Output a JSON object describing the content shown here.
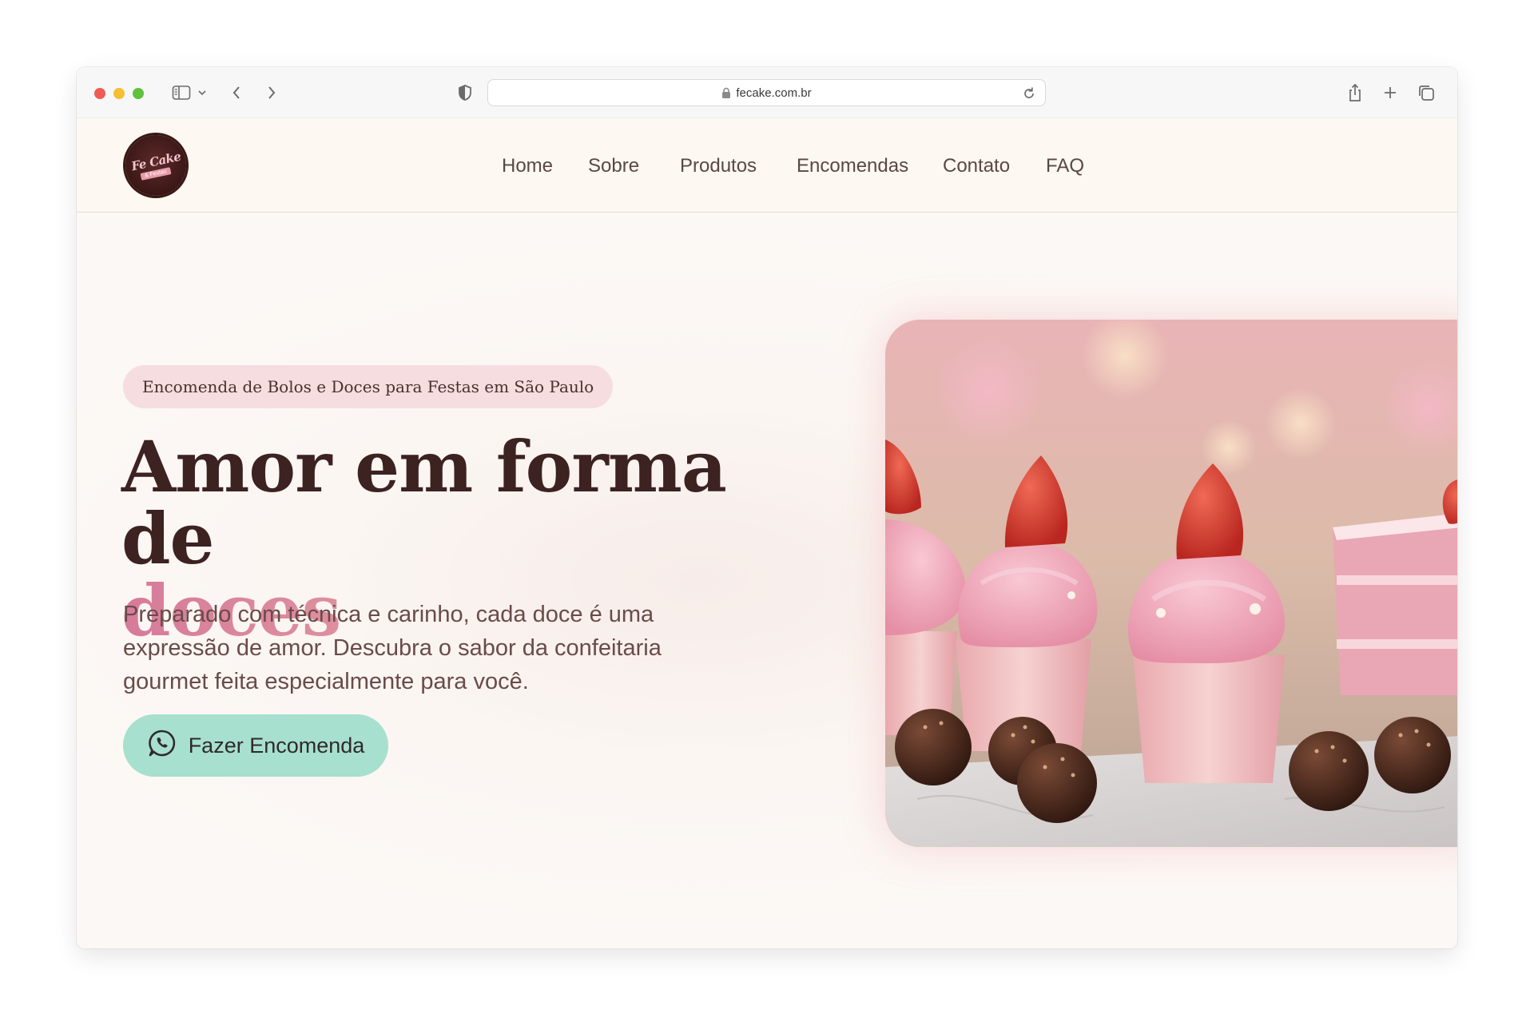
{
  "browser": {
    "url": "fecake.com.br",
    "icons": [
      "sidebar-icon",
      "chevron-down-icon",
      "back-icon",
      "forward-icon",
      "shield-icon",
      "lock-icon",
      "reload-icon",
      "share-icon",
      "new-tab-icon",
      "tabs-overview-icon"
    ]
  },
  "header": {
    "logo_text": "Fe Cake",
    "logo_subtext": "& Festas",
    "nav": [
      "Home",
      "Sobre",
      "Produtos",
      "Encomendas",
      "Contato",
      "FAQ"
    ]
  },
  "hero": {
    "badge": "Encomenda de Bolos e Doces para Festas em São Paulo",
    "headline_line1": "Amor em forma de",
    "headline_accent": "doces",
    "subtext": "Preparado com técnica e carinho, cada doce é uma expressão de amor. Descubra o sabor da confeitaria gourmet feita especialmente para você.",
    "cta_label": "Fazer Encomenda",
    "cta_icon": "whatsapp-icon",
    "image_subject": "cupcakes-strawberry-brigadeiros"
  },
  "colors": {
    "page_bg": "#fcf8f5",
    "header_bg": "#fdf8f1",
    "badge_bg": "#f5dde0",
    "headline": "#3c2220",
    "accent_gradient_start": "#d67b9a",
    "accent_gradient_end": "#efc4a8",
    "body_text": "#6a4b49",
    "cta_bg": "#a7e0cf"
  }
}
